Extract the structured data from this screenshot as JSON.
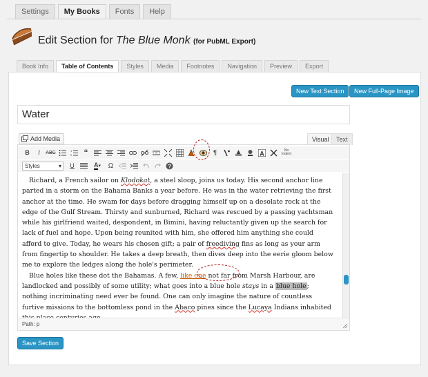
{
  "top_tabs": [
    "Settings",
    "My Books",
    "Fonts",
    "Help"
  ],
  "header": {
    "prefix": "Edit Section for ",
    "book_title": "The Blue Monk",
    "suffix": "(for PubML Export)"
  },
  "sub_tabs": [
    "Book Info",
    "Table of Contents",
    "Styles",
    "Media",
    "Footnotes",
    "Navigation",
    "Preview",
    "Export"
  ],
  "buttons": {
    "new_text_section": "New Text Section",
    "new_fullpage_image": "New Full-Page Image",
    "add_media": "Add Media",
    "save_section": "Save Section"
  },
  "section_title": "Water",
  "editor_tabs": {
    "visual": "Visual",
    "text": "Text"
  },
  "toolbar": {
    "styles_value": "Styles",
    "no_indent_label": "No Indent"
  },
  "content": {
    "p1": {
      "a": "Richard, a French sailor on ",
      "b": "Klodokat",
      "c": ", a steel sloop, joins us today. His second anchor line parted in a storm on the Bahama Banks a year before. He was in the water retrieving the first anchor at the time. He swam for days before dragging himself up on a desolate rock at the edge of the Gulf Stream. Thirsty and sunburned, Richard was rescued by a passing yachtsman while his girlfriend waited, despondent, in Bimini, having reluctantly given up the search for lack of fuel and hope. Upon being reunited with him, she offered him anything she could afford to give. Today, he wears his chosen gift; a pair of ",
      "d": "freediving",
      "e": " fins as long as your arm from fingertip to shoulder. He takes a deep breath, then dives deep into the eerie gloom below me to explore the ledges along the hole's perimeter."
    },
    "p2": {
      "a": "Blue holes like these dot the Bahamas. A few, ",
      "b": "like one",
      "c": " not far from Marsh Harbour, are landlocked and possibly of some utility; what goes into a blue hole ",
      "d": "stays",
      "e": " in a ",
      "f": "blue hole",
      "g": "; nothing incriminating need ever be found. One can only imagine the nature of countless furtive missions to the bottomless pond in the ",
      "h": "Abaco",
      "i": " pines since the ",
      "j": "Lucaya",
      "k": " Indians inhabited this place centuries ago."
    },
    "ornament": "❦"
  },
  "path_bar": "Path: p"
}
